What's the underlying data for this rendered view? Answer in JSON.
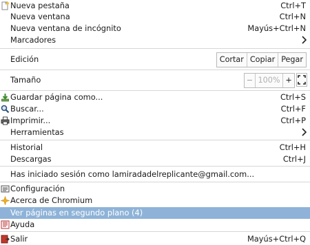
{
  "menu": {
    "new_tab": {
      "label": "Nueva pestaña",
      "shortcut": "Ctrl+T"
    },
    "new_window": {
      "label": "Nueva ventana",
      "shortcut": "Ctrl+N"
    },
    "incognito": {
      "label": "Nueva ventana de incógnito",
      "shortcut": "Mayús+Ctrl+N"
    },
    "bookmarks": {
      "label": "Marcadores"
    },
    "edit": {
      "label": "Edición",
      "cut": "Cortar",
      "copy": "Copiar",
      "paste": "Pegar"
    },
    "zoom": {
      "label": "Tamaño",
      "minus": "−",
      "value": "100%",
      "plus": "+"
    },
    "save_page": {
      "label": "Guardar página como...",
      "shortcut": "Ctrl+S"
    },
    "find": {
      "label": "Buscar...",
      "shortcut": "Ctrl+F"
    },
    "print": {
      "label": "Imprimir...",
      "shortcut": "Ctrl+P"
    },
    "tools": {
      "label": "Herramientas"
    },
    "history": {
      "label": "Historial",
      "shortcut": "Ctrl+H"
    },
    "downloads": {
      "label": "Descargas",
      "shortcut": "Ctrl+J"
    },
    "signed_in": {
      "label": "Has iniciado sesión como lamiradadelreplicante@gmail.com..."
    },
    "settings": {
      "label": "Configuración"
    },
    "about": {
      "label": "Acerca de Chromium"
    },
    "background_pages": {
      "label": "Ver páginas en segundo plano (4)"
    },
    "help": {
      "label": "Ayuda"
    },
    "exit": {
      "label": "Salir",
      "shortcut": "Mayús+Ctrl+Q"
    }
  },
  "colors": {
    "highlight": "#8fb3d8",
    "separator": "#d6d6d6"
  }
}
